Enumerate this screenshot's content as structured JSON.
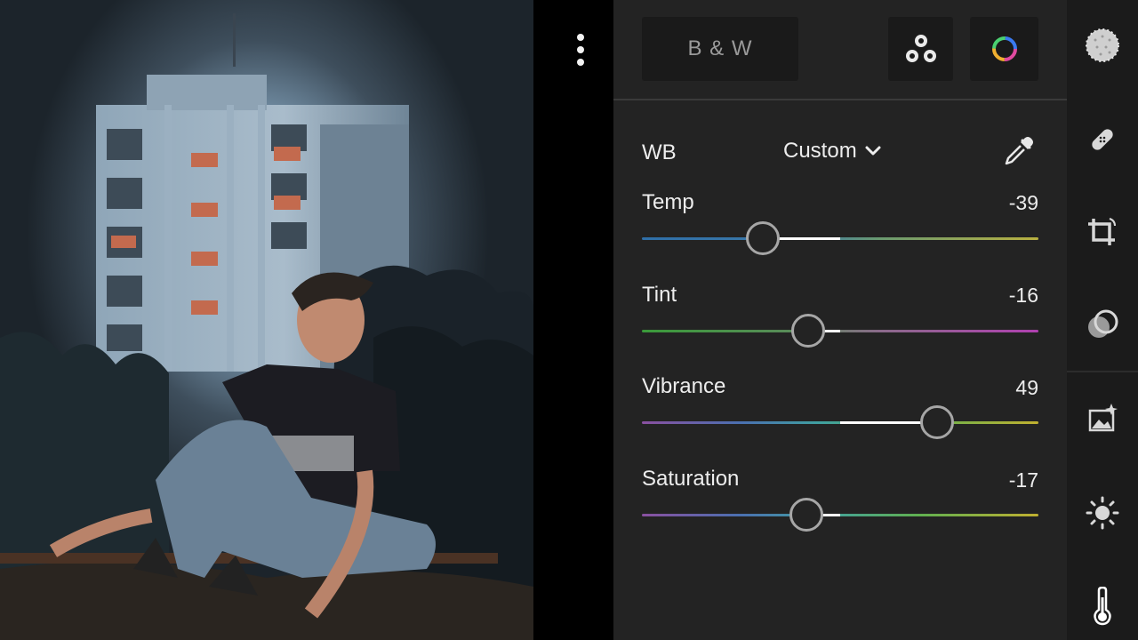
{
  "header": {
    "bw_label": "B & W",
    "more_icon": "more-vertical-icon",
    "mix_icon": "color-mix-icon",
    "grading_icon": "color-grading-icon"
  },
  "white_balance": {
    "label": "WB",
    "mode": "Custom",
    "dropdown_icon": "chevron-down-icon",
    "picker_icon": "eyedropper-icon"
  },
  "sliders": [
    {
      "label": "Temp",
      "value": "-39",
      "numeric": -39,
      "min": -100,
      "max": 100
    },
    {
      "label": "Tint",
      "value": "-16",
      "numeric": -16,
      "min": -100,
      "max": 100
    },
    {
      "label": "Vibrance",
      "value": "49",
      "numeric": 49,
      "min": -100,
      "max": 100
    },
    {
      "label": "Saturation",
      "value": "-17",
      "numeric": -17,
      "min": -100,
      "max": 100
    }
  ],
  "tools": [
    "selective-mask-icon",
    "healing-icon",
    "crop-icon",
    "masking-icon",
    "presets-icon",
    "light-icon",
    "color-icon"
  ],
  "colors": {
    "panel_bg": "#232323",
    "rail_bg": "#1b1b1b",
    "thumb_border": "#a6a6a6",
    "text": "#ededed"
  }
}
